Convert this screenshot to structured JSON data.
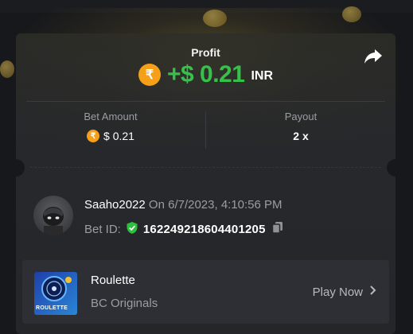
{
  "profit": {
    "label": "Profit",
    "currency_symbol": "₹",
    "value": "+$ 0.21",
    "currency": "INR"
  },
  "bet_amount": {
    "label": "Bet Amount",
    "currency_symbol": "₹",
    "value": "$ 0.21"
  },
  "payout": {
    "label": "Payout",
    "value": "2 x"
  },
  "user": {
    "name": "Saaho2022",
    "on_text": "On 6/7/2023, 4:10:56 PM"
  },
  "bet_id": {
    "label": "Bet ID:",
    "value": "162249218604401205"
  },
  "game": {
    "name": "Roulette",
    "provider": "BC Originals",
    "thumb_text": "ROULETTE",
    "play_label": "Play Now"
  },
  "icons": {
    "share": "share-icon",
    "shield": "shield-check-icon",
    "copy": "copy-icon",
    "chevron": "chevron-right-icon"
  },
  "colors": {
    "profit_green": "#36c24a",
    "coin": "#f6a01a",
    "background": "#17181b",
    "card": "#26282c"
  }
}
